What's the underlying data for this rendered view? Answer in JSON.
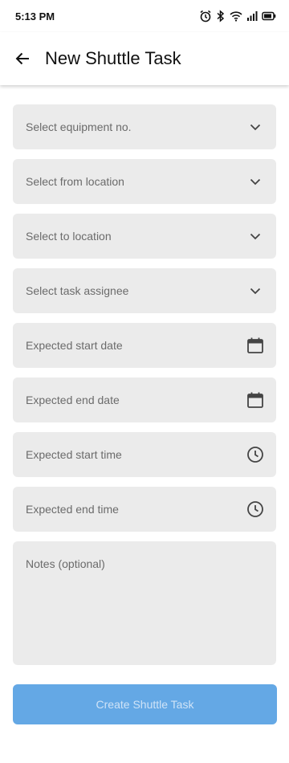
{
  "status_bar": {
    "time": "5:13 PM",
    "icons": [
      "alarm-icon",
      "bluetooth-icon",
      "wifi-icon",
      "signal-icon",
      "battery-icon"
    ]
  },
  "app_bar": {
    "back_icon": "arrow-back-icon",
    "title": "New Shuttle Task"
  },
  "form": {
    "equipment": {
      "placeholder": "Select equipment no.",
      "icon": "chevron-down-icon"
    },
    "from_location": {
      "placeholder": "Select from location",
      "icon": "chevron-down-icon"
    },
    "to_location": {
      "placeholder": "Select to location",
      "icon": "chevron-down-icon"
    },
    "assignee": {
      "placeholder": "Select task assignee",
      "icon": "chevron-down-icon"
    },
    "start_date": {
      "placeholder": "Expected start date",
      "icon": "calendar-icon"
    },
    "end_date": {
      "placeholder": "Expected end date",
      "icon": "calendar-icon"
    },
    "start_time": {
      "placeholder": "Expected start time",
      "icon": "clock-icon"
    },
    "end_time": {
      "placeholder": "Expected end time",
      "icon": "clock-icon"
    },
    "notes": {
      "placeholder": "Notes (optional)"
    }
  },
  "submit": {
    "label": "Create Shuttle Task",
    "enabled": false,
    "color": "#64a8e5"
  }
}
